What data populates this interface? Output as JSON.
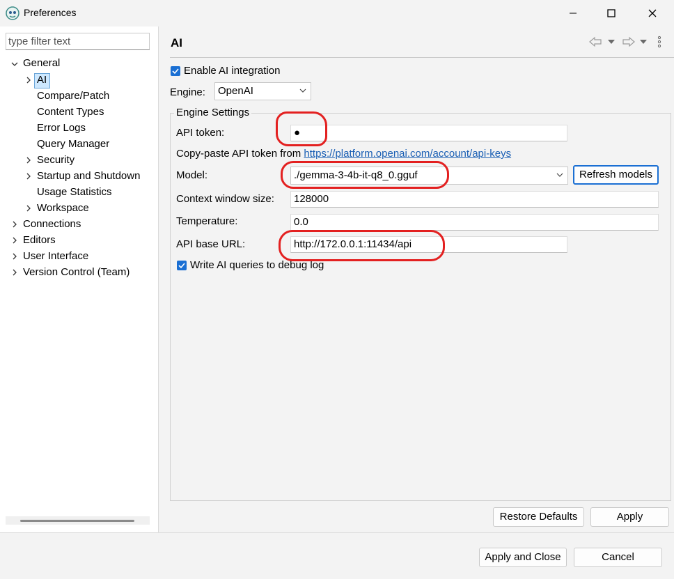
{
  "window": {
    "title": "Preferences",
    "controls": {
      "minimize": "minimize",
      "maximize": "maximize",
      "close": "close"
    }
  },
  "sidebar": {
    "filter_placeholder": "type filter text",
    "items": [
      {
        "label": "General",
        "expanded": true
      },
      {
        "label": "AI",
        "selected": true
      },
      {
        "label": "Compare/Patch"
      },
      {
        "label": "Content Types"
      },
      {
        "label": "Error Logs"
      },
      {
        "label": "Query Manager"
      },
      {
        "label": "Security"
      },
      {
        "label": "Startup and Shutdown"
      },
      {
        "label": "Usage Statistics"
      },
      {
        "label": "Workspace"
      },
      {
        "label": "Connections"
      },
      {
        "label": "Editors"
      },
      {
        "label": "User Interface"
      },
      {
        "label": "Version Control (Team)"
      }
    ]
  },
  "page": {
    "title": "AI",
    "enable_label": "Enable AI integration",
    "enable_checked": true,
    "engine_label": "Engine:",
    "engine_value": "OpenAI",
    "group_title": "Engine Settings",
    "api_token_label": "API token:",
    "api_token_value": "●",
    "copy_paste_text": "Copy-paste API token from ",
    "copy_paste_link": "https://platform.openai.com/account/api-keys",
    "model_label": "Model:",
    "model_value": "./gemma-3-4b-it-q8_0.gguf",
    "refresh_label": "Refresh models",
    "context_label": "Context window size:",
    "context_value": "128000",
    "temperature_label": "Temperature:",
    "temperature_value": "0.0",
    "base_url_label": "API base URL:",
    "base_url_value": "http://172.0.0.1:11434/api",
    "debug_label": "Write AI queries to debug log",
    "debug_checked": true,
    "restore_label": "Restore Defaults",
    "apply_label": "Apply"
  },
  "footer": {
    "apply_close_label": "Apply and Close",
    "cancel_label": "Cancel"
  },
  "colors": {
    "accent": "#1a6fd3",
    "link": "#1a5fb4",
    "annotation": "#e32020",
    "selection": "#cde8ff"
  }
}
